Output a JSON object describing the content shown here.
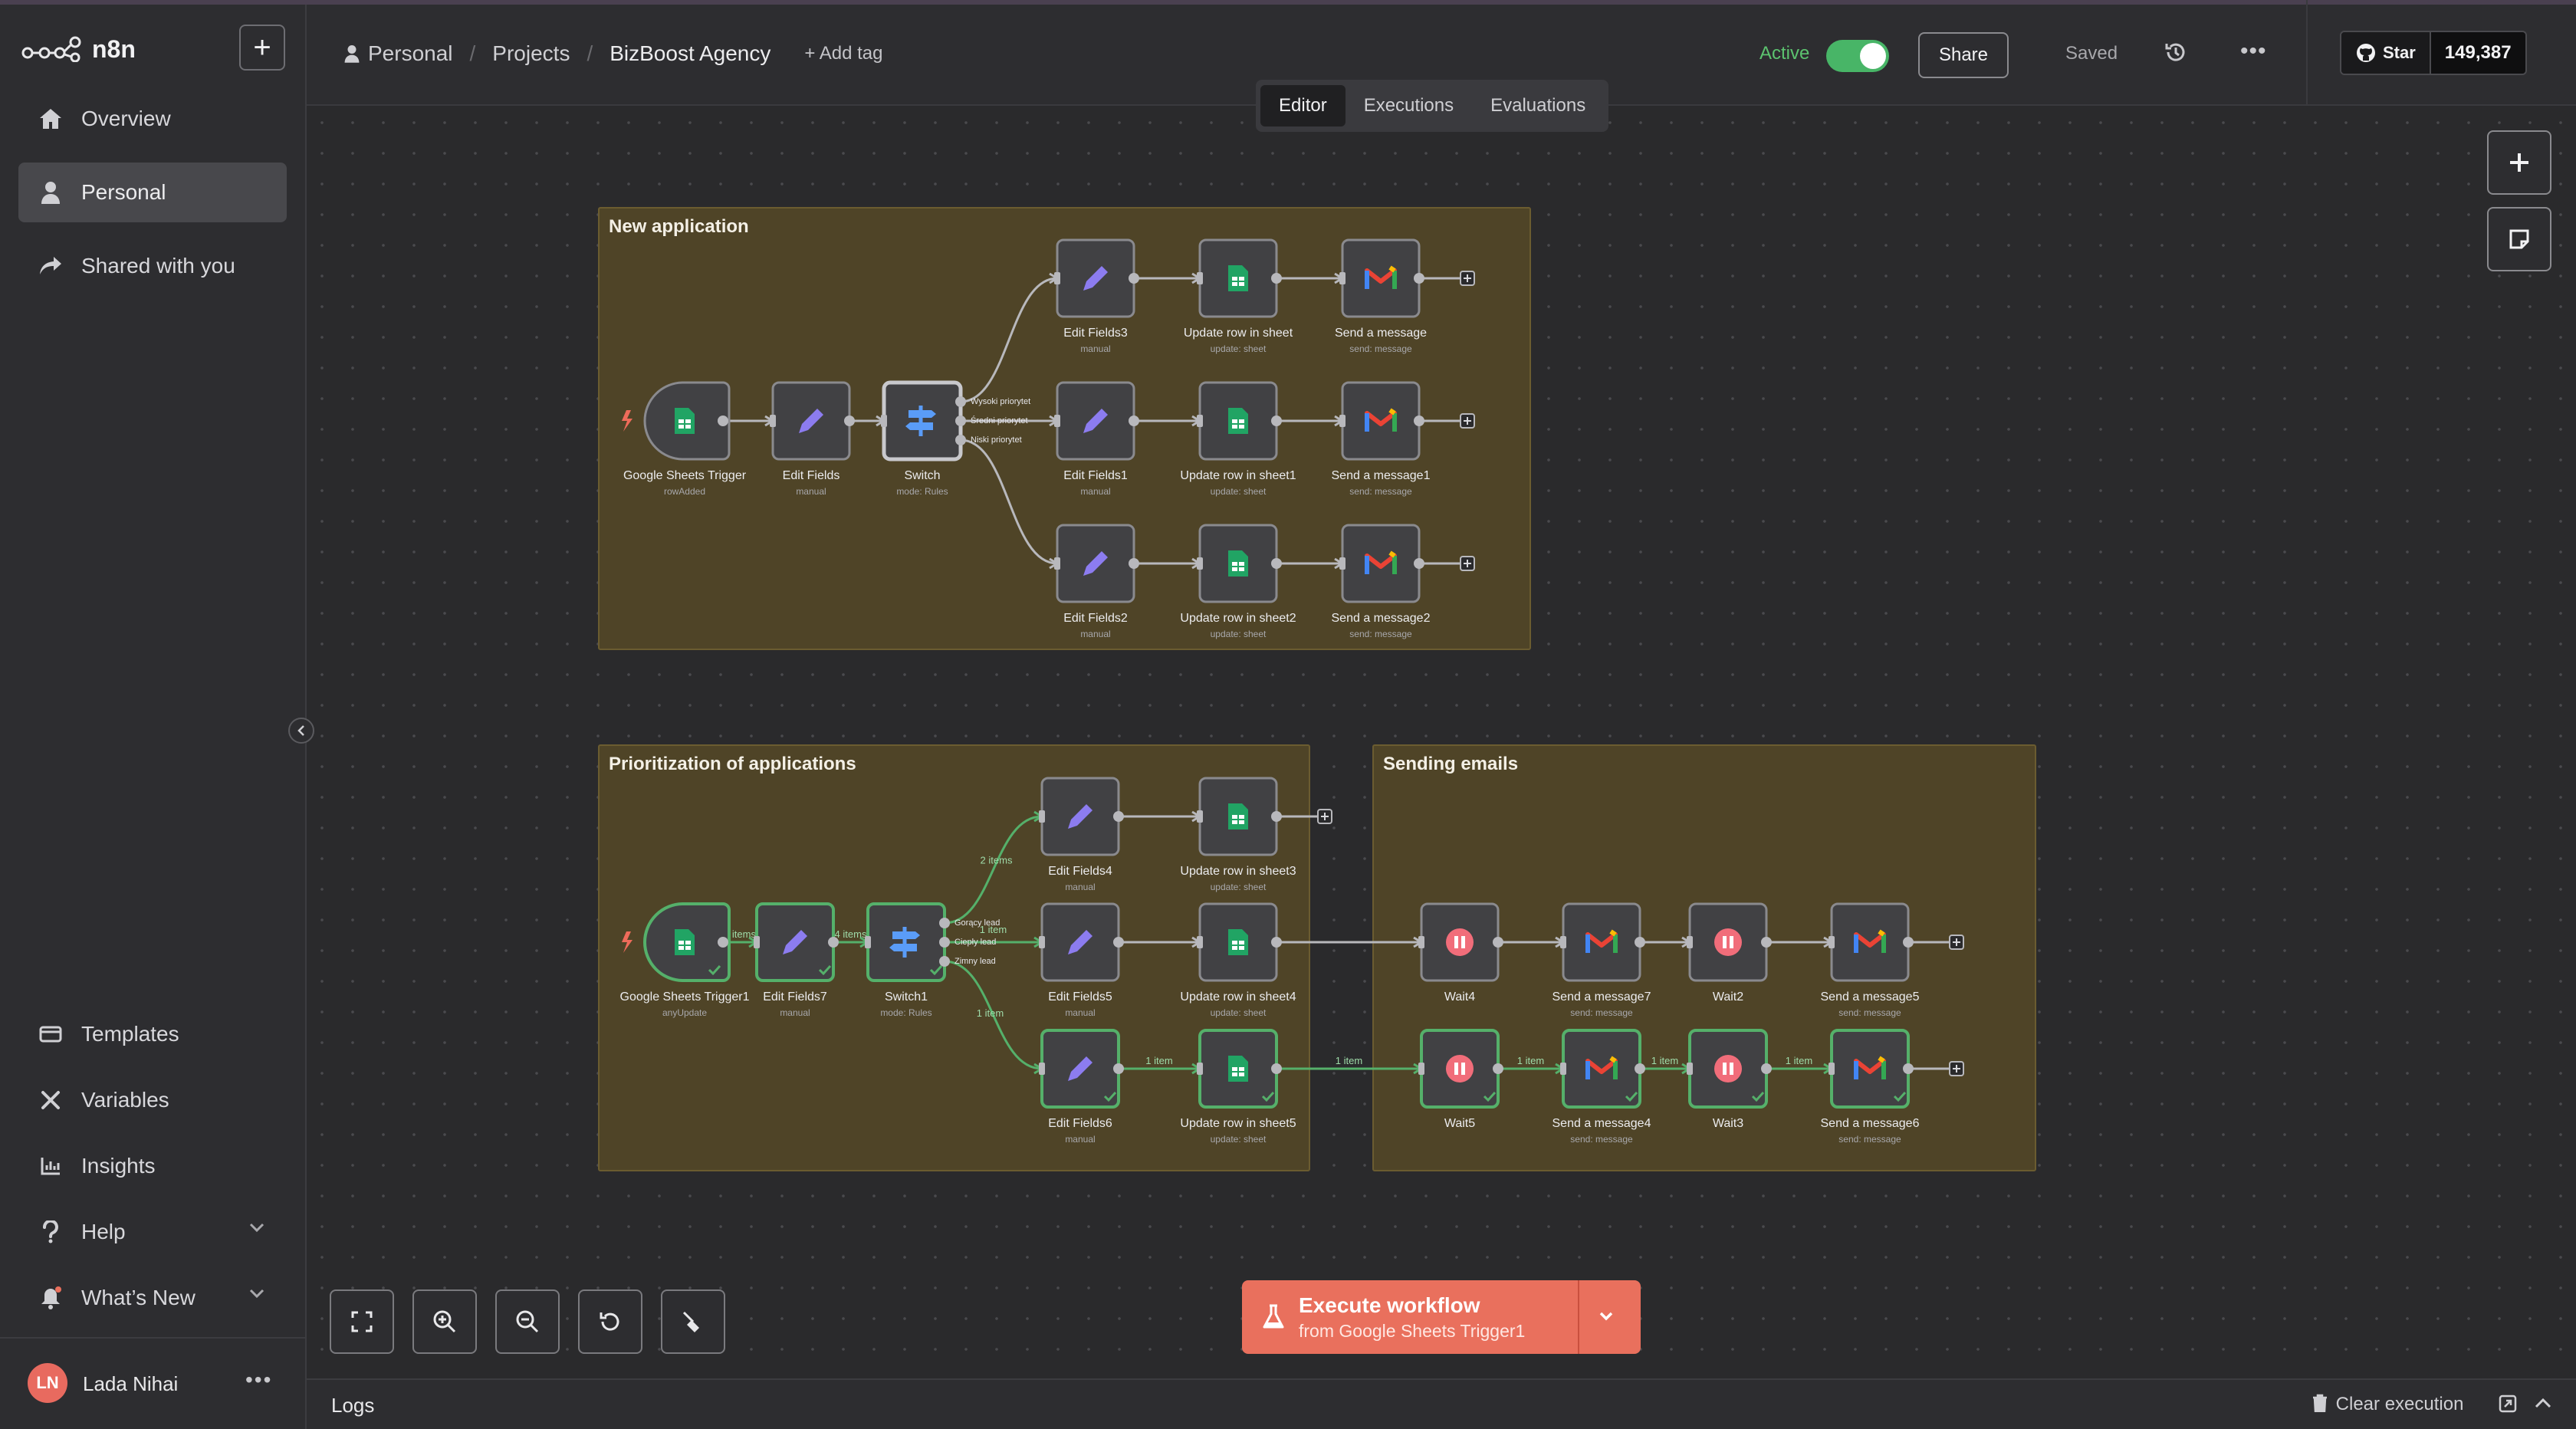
{
  "app": {
    "name": "n8n",
    "new_button": "+"
  },
  "sidebar": {
    "items": [
      {
        "label": "Overview",
        "icon": "home-icon"
      },
      {
        "label": "Personal",
        "icon": "user-icon"
      },
      {
        "label": "Shared with you",
        "icon": "share-icon"
      }
    ],
    "bottom_items": [
      {
        "label": "Templates",
        "icon": "templates-icon"
      },
      {
        "label": "Variables",
        "icon": "variables-icon"
      },
      {
        "label": "Insights",
        "icon": "insights-icon"
      },
      {
        "label": "Help",
        "icon": "help-icon"
      },
      {
        "label": "What’s New",
        "icon": "bell-icon"
      }
    ],
    "user": {
      "initials": "LN",
      "name": "Lada Nihai",
      "more": "•••"
    }
  },
  "header": {
    "breadcrumb": [
      "Personal",
      "Projects",
      "BizBoost Agency"
    ],
    "add_tag": "+ Add tag",
    "active_label": "Active",
    "active": true,
    "share": "Share",
    "saved": "Saved",
    "more": "•••",
    "github": {
      "star": "Star",
      "count": "149,387"
    }
  },
  "tabs": [
    {
      "label": "Editor",
      "selected": true
    },
    {
      "label": "Executions",
      "selected": false
    },
    {
      "label": "Evaluations",
      "selected": false
    }
  ],
  "execute": {
    "title": "Execute workflow",
    "subtitle": "from Google Sheets Trigger1"
  },
  "logs": {
    "title": "Logs",
    "clear": "Clear execution"
  },
  "colors": {
    "accent": "#e9705d",
    "group_bg": "#4f4427",
    "success": "#48b567"
  },
  "workflow": {
    "groups": [
      {
        "id": "g1",
        "title": "New application"
      },
      {
        "id": "g2",
        "title": "Prioritization of applications"
      },
      {
        "id": "g3",
        "title": "Sending emails"
      }
    ],
    "nodes": [
      {
        "id": "gst",
        "icon": "sheets",
        "name": "Google Sheets Trigger",
        "sub": "rowAdded",
        "trigger": true
      },
      {
        "id": "ef",
        "icon": "pencil",
        "name": "Edit Fields",
        "sub": "manual"
      },
      {
        "id": "sw",
        "icon": "switch",
        "name": "Switch",
        "sub": "mode: Rules"
      },
      {
        "id": "ef3",
        "icon": "pencil",
        "name": "Edit Fields3",
        "sub": "manual"
      },
      {
        "id": "ur",
        "icon": "sheets",
        "name": "Update row in sheet",
        "sub": "update: sheet"
      },
      {
        "id": "sm",
        "icon": "gmail",
        "name": "Send a message",
        "sub": "send: message"
      },
      {
        "id": "ef1",
        "icon": "pencil",
        "name": "Edit Fields1",
        "sub": "manual"
      },
      {
        "id": "ur1",
        "icon": "sheets",
        "name": "Update row in sheet1",
        "sub": "update: sheet"
      },
      {
        "id": "sm1",
        "icon": "gmail",
        "name": "Send a message1",
        "sub": "send: message"
      },
      {
        "id": "ef2",
        "icon": "pencil",
        "name": "Edit Fields2",
        "sub": "manual"
      },
      {
        "id": "ur2",
        "icon": "sheets",
        "name": "Update row in sheet2",
        "sub": "update: sheet"
      },
      {
        "id": "sm2",
        "icon": "gmail",
        "name": "Send a message2",
        "sub": "send: message"
      },
      {
        "id": "gst1",
        "icon": "sheets",
        "name": "Google Sheets Trigger1",
        "sub": "anyUpdate",
        "trigger": true,
        "done": true
      },
      {
        "id": "ef7",
        "icon": "pencil",
        "name": "Edit Fields7",
        "sub": "manual",
        "done": true
      },
      {
        "id": "sw1",
        "icon": "switch",
        "name": "Switch1",
        "sub": "mode: Rules",
        "done": true
      },
      {
        "id": "ef4",
        "icon": "pencil",
        "name": "Edit Fields4",
        "sub": "manual"
      },
      {
        "id": "ur3",
        "icon": "sheets",
        "name": "Update row in sheet3",
        "sub": "update: sheet"
      },
      {
        "id": "ef5",
        "icon": "pencil",
        "name": "Edit Fields5",
        "sub": "manual"
      },
      {
        "id": "ur4",
        "icon": "sheets",
        "name": "Update row in sheet4",
        "sub": "update: sheet"
      },
      {
        "id": "ef6",
        "icon": "pencil",
        "name": "Edit Fields6",
        "sub": "manual",
        "done": true
      },
      {
        "id": "ur5",
        "icon": "sheets",
        "name": "Update row in sheet5",
        "sub": "update: sheet",
        "done": true
      },
      {
        "id": "w4",
        "icon": "wait",
        "name": "Wait4",
        "sub": ""
      },
      {
        "id": "sm7",
        "icon": "gmail",
        "name": "Send a message7",
        "sub": "send: message"
      },
      {
        "id": "w2",
        "icon": "wait",
        "name": "Wait2",
        "sub": ""
      },
      {
        "id": "sm5",
        "icon": "gmail",
        "name": "Send a message5",
        "sub": "send: message"
      },
      {
        "id": "w5",
        "icon": "wait",
        "name": "Wait5",
        "sub": "",
        "done": true
      },
      {
        "id": "sm4",
        "icon": "gmail",
        "name": "Send a message4",
        "sub": "send: message",
        "done": true
      },
      {
        "id": "w3",
        "icon": "wait",
        "name": "Wait3",
        "sub": "",
        "done": true
      },
      {
        "id": "sm6",
        "icon": "gmail",
        "name": "Send a message6",
        "sub": "send: message",
        "done": true
      }
    ],
    "switch_outputs": [
      "Wysoki priorytet",
      "Średni priorytet",
      "Niski priorytet"
    ],
    "switch1_outputs": [
      "Gorący lead",
      "Ciepły lead",
      "Zimny lead"
    ],
    "edge_labels": [
      "4 items",
      "4 items",
      "2 items",
      "1 item",
      "1 item",
      "1 item",
      "1 item",
      "1 item",
      "1 item",
      "1 item"
    ]
  }
}
